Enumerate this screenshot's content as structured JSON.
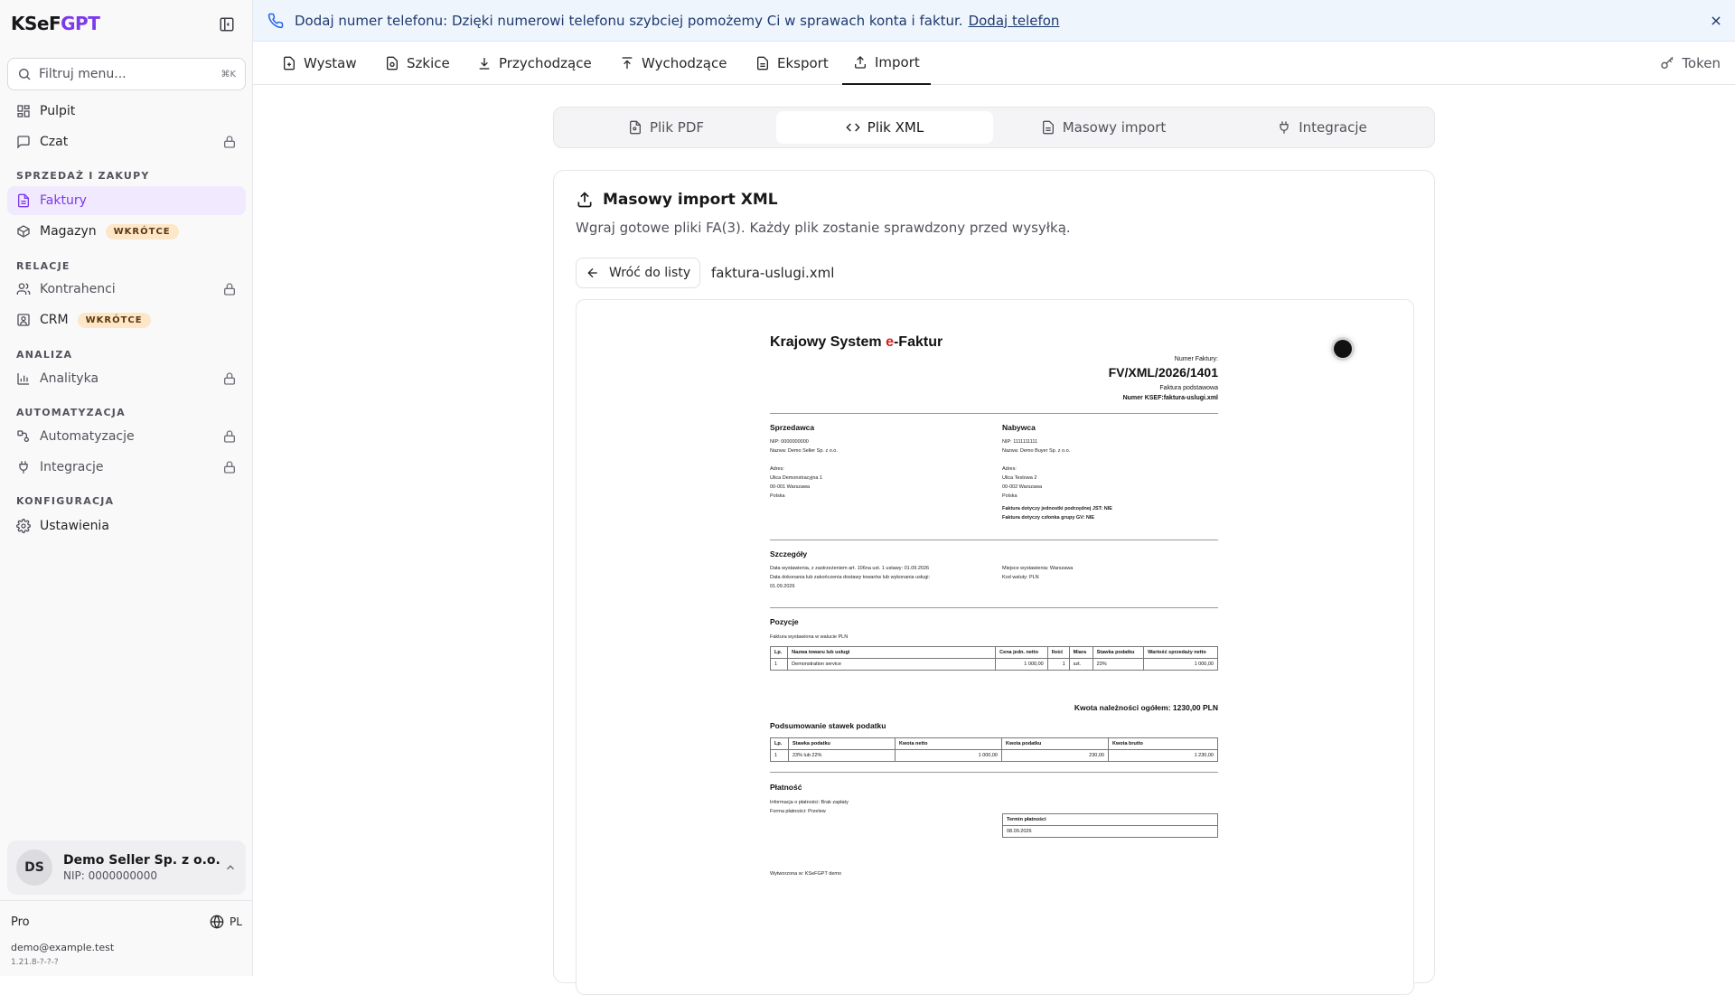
{
  "app": {
    "logo_ksef": "KSeF",
    "logo_gpt": "GPT"
  },
  "sidebar": {
    "filter_placeholder": "Filtruj menu...",
    "filter_shortcut": "⌘K",
    "items": {
      "pulpit": "Pulpit",
      "czat": "Czat",
      "faktury": "Faktury",
      "magazyn": "Magazyn",
      "kontrahenci": "Kontrahenci",
      "crm": "CRM",
      "analityka": "Analityka",
      "automatyzacje": "Automatyzacje",
      "integracje": "Integracje",
      "ustawienia": "Ustawienia"
    },
    "badge_soon": "WKRÓTCE",
    "sections": {
      "sales": "SPRZEDAŻ I ZAKUPY",
      "relations": "RELACJE",
      "analysis": "ANALIZA",
      "automation": "AUTOMATYZACJA",
      "config": "KONFIGURACJA"
    },
    "user": {
      "initials": "DS",
      "name": "Demo Seller Sp. z o.o.",
      "nip": "NIP: 0000000000"
    },
    "plan": "Pro",
    "lang": "PL",
    "email": "demo@example.test",
    "version": "1.21.8-?-?-?"
  },
  "banner": {
    "text": "Dodaj numer telefonu: Dzięki numerowi telefonu szybciej pomożemy Ci w sprawach konta i faktur.",
    "link": "Dodaj telefon"
  },
  "topnav": {
    "tabs": {
      "wystaw": "Wystaw",
      "szkice": "Szkice",
      "przychodzace": "Przychodzące",
      "wychodzace": "Wychodzące",
      "eksport": "Eksport",
      "import": "Import"
    },
    "token": "Token"
  },
  "subtabs": {
    "pdf": "Plik PDF",
    "xml": "Plik XML",
    "mass": "Masowy import",
    "integr": "Integracje"
  },
  "card": {
    "title": "Masowy import XML",
    "desc": "Wgraj gotowe pliki FA(3). Każdy plik zostanie sprawdzony przed wysyłką.",
    "back": "Wróć do listy",
    "filename": "faktura-uslugi.xml"
  },
  "doc": {
    "title_pre": "Krajowy System ",
    "title_e": "e",
    "title_post": "-Faktur",
    "inv_label": "Numer Faktury:",
    "inv_number": "FV/XML/2026/1401",
    "inv_type": "Faktura podstawowa",
    "ksef": "Numer KSEF:faktura-uslugi.xml",
    "seller_h": "Sprzedawca",
    "seller_nip": "NIP: 0000000000",
    "seller_name": "Nazwa: Demo Seller Sp. z o.o.",
    "seller_addr_l": "Adres:",
    "seller_addr1": "Ulica Demonstracyjna 1",
    "seller_addr2": "00-001 Warszawa",
    "seller_addr3": "Polska",
    "buyer_h": "Nabywca",
    "buyer_nip": "NIP: 1111111111",
    "buyer_name": "Nazwa: Demo Buyer Sp. z o.o.",
    "buyer_addr_l": "Adres:",
    "buyer_addr1": "Ulica Testowa 2",
    "buyer_addr2": "00-002 Warszawa",
    "buyer_addr3": "Polska",
    "jst": "Faktura dotyczy jednostki podrzędnej JST: NIE",
    "gv": "Faktura dotyczy członka grupy GV: NIE",
    "details_h": "Szczegóły",
    "details_1": "Data wystawienia, z zastrzeżeniem art. 106na ust. 1 ustawy: 01.09.2026",
    "details_2": "Data dokonania lub zakończenia dostawy towarów lub wykonania usługi:",
    "details_3": "01.09.2026",
    "place": "Miejsce wystawienia: Warszawa",
    "currency": "Kod waluty: PLN",
    "items_h": "Pozycje",
    "items_note": "Faktura wystawiona w walucie PLN",
    "items_cols": [
      "Lp.",
      "Nazwa towaru lub usługi",
      "Cena jedn. netto",
      "Ilość",
      "Miara",
      "Stawka podatku",
      "Wartość sprzedaży netto"
    ],
    "items_row": [
      "1",
      "Demonstration service",
      "1 000,00",
      "1",
      "szt.",
      "23%",
      "1 000,00"
    ],
    "total": "Kwota należności ogółem: 1230,00 PLN",
    "tax_h": "Podsumowanie stawek podatku",
    "tax_cols": [
      "Lp.",
      "Stawka podatku",
      "Kwota netto",
      "Kwota podatku",
      "Kwota brutto"
    ],
    "tax_row": [
      "1",
      "23% lub 22%",
      "1 000,00",
      "230,00",
      "1 230,00"
    ],
    "pay_h": "Płatność",
    "pay_info": "Informacja o płatności: Brak zapłaty",
    "pay_form": "Forma płatności: Przelew",
    "term_h": "Termin płatności",
    "term_v": "08.09.2026",
    "gen": "Wytworzona w: KSeFGPT demo"
  }
}
